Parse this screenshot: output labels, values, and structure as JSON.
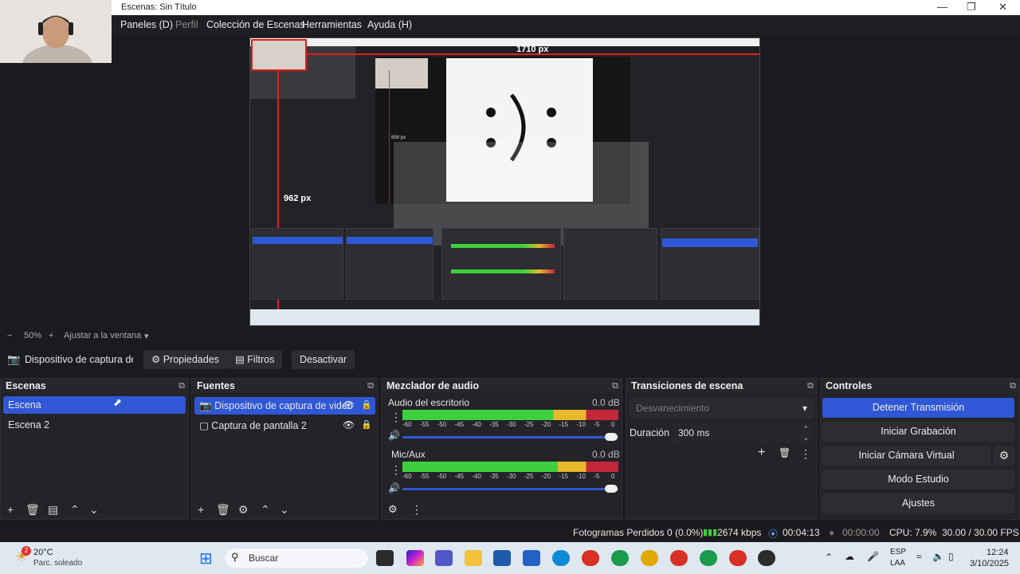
{
  "window": {
    "title": "Escenas: Sin Título",
    "minimize_icon": "minimize-icon",
    "maximize_icon": "maximize-icon",
    "close_icon": "close-icon"
  },
  "menu": {
    "items": [
      "Paneles (D)",
      "Perfil",
      "Colección de Escenas",
      "Herramientas",
      "Ayuda (H)"
    ]
  },
  "preview": {
    "width_label": "1710 px",
    "height_label": "962 px",
    "inner_height_label": "858 px"
  },
  "zoom": {
    "minus": "−",
    "value": "50%",
    "plus": "+",
    "fit_label": "Ajustar a la ventana",
    "dropdown_icon": "▾"
  },
  "source_toolbar": {
    "source_name": "Dispositivo de captura de v",
    "properties": "Propiedades",
    "filters": "Filtros",
    "deactivate": "Desactivar"
  },
  "scenes": {
    "title": "Escenas",
    "items": [
      "Escena",
      "Escena 2"
    ],
    "selected": "Escena"
  },
  "sources": {
    "title": "Fuentes",
    "items": [
      "Dispositivo de captura de video",
      "Captura de pantalla 2"
    ]
  },
  "mixer": {
    "title": "Mezclador de audio",
    "channels": [
      {
        "name": "Audio del escritorio",
        "db": "0.0 dB",
        "level": 0.7
      },
      {
        "name": "Mic/Aux",
        "db": "0.0 dB",
        "level": 0.72
      }
    ],
    "scale": [
      "-60",
      "-55",
      "-50",
      "-45",
      "-40",
      "-35",
      "-30",
      "-25",
      "-20",
      "-15",
      "-10",
      "-5",
      "0"
    ]
  },
  "transitions": {
    "title": "Transiciones de escena",
    "type": "Desvanecimiento",
    "duration_label": "Duración",
    "duration_value": "300 ms"
  },
  "controls": {
    "title": "Controles",
    "stop_stream": "Detener Transmisión",
    "start_recording": "Iniciar Grabación",
    "start_virtual_cam": "Iniciar Cámara Virtual",
    "studio_mode": "Modo Estudio",
    "settings": "Ajustes"
  },
  "status": {
    "dropped_frames": "Fotogramas Perdidos 0 (0.0%)",
    "bitrate": "2674 kbps",
    "stream_time": "00:04:13",
    "rec_time": "00:00:00",
    "cpu": "CPU: 7.9%",
    "fps": "30.00 / 30.00 FPS"
  },
  "taskbar": {
    "weather_badge": "2",
    "temperature": "20°C",
    "weather_desc": "Parc. soleado",
    "search_placeholder": "Buscar",
    "lang_top": "ESP",
    "lang_bottom": "LAA",
    "time": "12:24",
    "date": "3/10/2025"
  },
  "colors": {
    "accent": "#2f57d6",
    "meter_green": "#3ecf3e",
    "meter_yellow": "#e5b92b",
    "meter_red": "#c2283a",
    "guide_red": "#e01e1e"
  }
}
